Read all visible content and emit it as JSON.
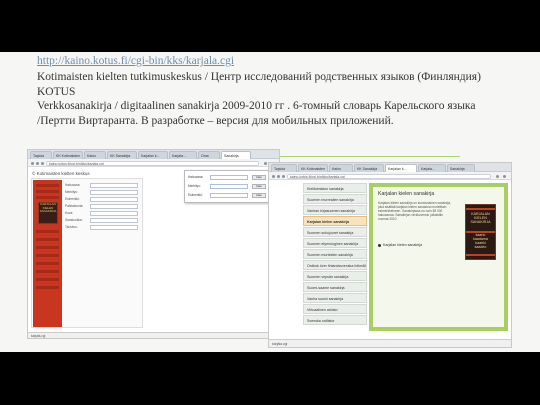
{
  "caption": {
    "url": "http://kaino.kotus.fi/cgi-bin/kks/karjala.cgi",
    "line2": "Kotimaisten kielten tutkimuskeskus / Центр исследований родственных языков (Финляндия)",
    "line3": "KOTUS",
    "line4": "Verkkosanakirja / digitaalinen sanakirja 2009-2010 гг . 6-томный словарь Карельского языка",
    "line5": "/Пертти Виртаранта. В разработке – версия для мобильных приложений."
  },
  "left_shot": {
    "tabs": [
      "Tapiola",
      "KK Kotimaisten",
      "Kaino",
      "KK Sanakirja",
      "Karjalan k...",
      "Karjala...",
      "Oma",
      "Sanakirja"
    ],
    "address": "kaino.kotus.fi/cgi-bin/kks/karjala.cgi",
    "header": "© Kotimaisten kielten keskus",
    "book_lines": [
      "KARJALAN",
      "KIELEN",
      "SANAKIRJA"
    ],
    "form_labels": [
      "Hakusana:",
      "Merkitys:",
      "Esimerkki:",
      "Paikkakunta:",
      "Kuva:",
      "Sanaluokka:",
      "Taivutus:"
    ],
    "popup_rows": [
      {
        "label": "Hakusana:",
        "button": "Hae"
      },
      {
        "label": "Merkitys:",
        "button": "Hae"
      },
      {
        "label": "Esimerkki:",
        "button": "Hae"
      }
    ],
    "taskbar": "karjala.cgi"
  },
  "right_shot": {
    "sidebar": [
      "Kielitoimiston sanakirja",
      "Suomen murrealien sanakirja",
      "Vanhan kirjasuomen sanakirja",
      "Karjalan kielen sanakirja",
      "Suomen sukujuuret sanakirja",
      "Suomen etymologinen sanakirja",
      "Suomen murteiden sanakirja",
      "Ordbok över finlandssvenska folkmål",
      "Suomen vepsän sanakirja",
      "Suomi-saame sanakirja",
      "Vanha suomi sanakirja",
      "Virtuaalinen arkisto",
      "Svenska ordlistor"
    ],
    "active_index": 3,
    "title": "Karjalan kielen sanakirja",
    "paragraph": "Karjalan kielen sanakirja on kuusiosainen sanakirja, joka sisältää karjalan kielen sanastoa murteittain esimerkkeineen. Sanakirjassa on noin 85 000 hakusanaa. Sanakirjan verkkoversio julkaistiin vuonna 2010.",
    "link": "Karjalan kielen sanakirja",
    "book_lines": [
      "KARJALAN",
      "KIELEN",
      "SANAKIRJA",
      "",
      "kaarlo",
      "kaadama",
      "kaahki",
      "kaadeo"
    ],
    "taskbar": "karjala.cgi"
  },
  "colors": {
    "url": "#6b8fb0",
    "rule": "#a8d27a",
    "book_red": "#c8361f",
    "panel_green": "#a9cf63",
    "active_tab": "#f7e3bd"
  }
}
